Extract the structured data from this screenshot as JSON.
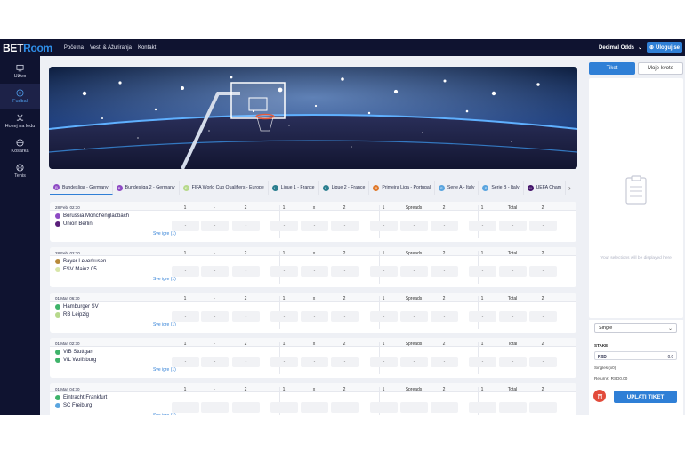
{
  "brand": {
    "part1": "BET",
    "part2": "Room"
  },
  "nav": [
    "Početna",
    "Vesti & Ažuriranja",
    "Kontakt"
  ],
  "odds_format": "Decimal Odds",
  "login_label": "Uloguj se",
  "sidebar": [
    {
      "label": "Uživo",
      "icon": "monitor-icon",
      "active": false
    },
    {
      "label": "Fudbal",
      "icon": "soccer-ball-icon",
      "active": true
    },
    {
      "label": "Hokej na ledu",
      "icon": "hockey-sticks-icon",
      "active": false
    },
    {
      "label": "Košarka",
      "icon": "basketball-icon",
      "active": false
    },
    {
      "label": "Tenis",
      "icon": "tennis-ball-icon",
      "active": false
    }
  ],
  "league_tabs": [
    {
      "label": "Bundesliga - Germany",
      "badge": "B",
      "color": "#8e4bc4"
    },
    {
      "label": "Bundesliga 2 - Germany",
      "badge": "B",
      "color": "#8e4bc4"
    },
    {
      "label": "FIFA World Cup Qualifiers - Europe",
      "badge": "F",
      "color": "#b7d98c"
    },
    {
      "label": "Ligue 1 - France",
      "badge": "L",
      "color": "#2a7e8f"
    },
    {
      "label": "Ligue 2 - France",
      "badge": "L",
      "color": "#2a7e8f"
    },
    {
      "label": "Primeira Liga - Portugal",
      "badge": "P",
      "color": "#e07a2c"
    },
    {
      "label": "Serie A - Italy",
      "badge": "S",
      "color": "#5aa5df"
    },
    {
      "label": "Serie B - Italy",
      "badge": "S",
      "color": "#5aa5df"
    },
    {
      "label": "UEFA Cham",
      "badge": "U",
      "color": "#44146b"
    }
  ],
  "market_headers": [
    "1",
    "-",
    "2",
    "1",
    "x",
    "2",
    "1",
    "Spreads",
    "2",
    "1",
    "Total",
    "2"
  ],
  "odd_placeholder": "-",
  "more_label": "Sve igre (1)",
  "matches": [
    {
      "date": "28 Feb, 02:30",
      "home": "Borussia Monchengladbach",
      "away": "Union Berlin",
      "home_color": "#8e4bc4",
      "away_color": "#5a1f7a"
    },
    {
      "date": "28 Feb, 02:30",
      "home": "Bayer Leverkusen",
      "away": "FSV Mainz 05",
      "home_color": "#b88a3a",
      "away_color": "#d8e6a8"
    },
    {
      "date": "01 Mar, 06:30",
      "home": "Hamburger SV",
      "away": "RB Leipzig",
      "home_color": "#3fb36a",
      "away_color": "#b7d98c"
    },
    {
      "date": "01 Mar, 02:30",
      "home": "VfB Stuttgart",
      "away": "VfL Wolfsburg",
      "home_color": "#3fb36a",
      "away_color": "#3fb36a"
    },
    {
      "date": "01 Mar, 04:30",
      "home": "Eintracht Frankfurt",
      "away": "SC Freiburg",
      "home_color": "#3fb36a",
      "away_color": "#5aa5df"
    }
  ],
  "right_tabs": [
    "Tiket",
    "Moje kvote"
  ],
  "slip_empty": "Your selections will be displayed here",
  "bet_type": "Single",
  "stake_label": "STAKE",
  "currency": "RSD",
  "stake_value": "0.0",
  "singles": "Singles (x0)",
  "returns": "Returns: RSD0.00",
  "payout_button": "UPLATI TIKET"
}
